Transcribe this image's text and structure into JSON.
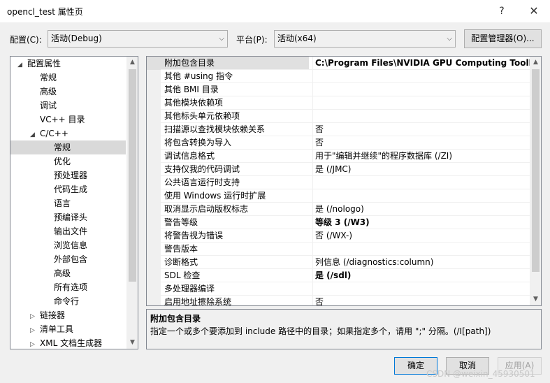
{
  "window": {
    "title": "opencl_test 属性页",
    "help_glyph": "?",
    "close_glyph": "✕"
  },
  "config": {
    "label": "配置(C):",
    "value": "活动(Debug)"
  },
  "platform": {
    "label": "平台(P):",
    "value": "活动(x64)"
  },
  "config_manager_label": "配置管理器(O)...",
  "tree": {
    "items": [
      {
        "label": "配置属性",
        "expander": "◢",
        "level": 0,
        "selected": false
      },
      {
        "label": "常规",
        "expander": "",
        "level": 1,
        "selected": false
      },
      {
        "label": "高级",
        "expander": "",
        "level": 1,
        "selected": false
      },
      {
        "label": "调试",
        "expander": "",
        "level": 1,
        "selected": false
      },
      {
        "label": "VC++ 目录",
        "expander": "",
        "level": 1,
        "selected": false
      },
      {
        "label": "C/C++",
        "expander": "◢",
        "level": 1,
        "selected": false
      },
      {
        "label": "常规",
        "expander": "",
        "level": 2,
        "selected": true
      },
      {
        "label": "优化",
        "expander": "",
        "level": 2,
        "selected": false
      },
      {
        "label": "预处理器",
        "expander": "",
        "level": 2,
        "selected": false
      },
      {
        "label": "代码生成",
        "expander": "",
        "level": 2,
        "selected": false
      },
      {
        "label": "语言",
        "expander": "",
        "level": 2,
        "selected": false
      },
      {
        "label": "预编译头",
        "expander": "",
        "level": 2,
        "selected": false
      },
      {
        "label": "输出文件",
        "expander": "",
        "level": 2,
        "selected": false
      },
      {
        "label": "浏览信息",
        "expander": "",
        "level": 2,
        "selected": false
      },
      {
        "label": "外部包含",
        "expander": "",
        "level": 2,
        "selected": false
      },
      {
        "label": "高级",
        "expander": "",
        "level": 2,
        "selected": false
      },
      {
        "label": "所有选项",
        "expander": "",
        "level": 2,
        "selected": false
      },
      {
        "label": "命令行",
        "expander": "",
        "level": 2,
        "selected": false
      },
      {
        "label": "链接器",
        "expander": "▷",
        "level": 1,
        "selected": false
      },
      {
        "label": "清单工具",
        "expander": "▷",
        "level": 1,
        "selected": false
      },
      {
        "label": "XML 文档生成器",
        "expander": "▷",
        "level": 1,
        "selected": false
      }
    ]
  },
  "properties": [
    {
      "name": "附加包含目录",
      "value": "C:\\Program Files\\NVIDIA GPU Computing Toolkit\\",
      "bold": true,
      "selected": true
    },
    {
      "name": "其他 #using 指令",
      "value": "",
      "bold": false,
      "selected": false
    },
    {
      "name": "其他 BMI 目录",
      "value": "",
      "bold": false,
      "selected": false
    },
    {
      "name": "其他模块依赖项",
      "value": "",
      "bold": false,
      "selected": false
    },
    {
      "name": "其他标头单元依赖项",
      "value": "",
      "bold": false,
      "selected": false
    },
    {
      "name": "扫描源以查找模块依赖关系",
      "value": "否",
      "bold": false,
      "selected": false
    },
    {
      "name": "将包含转换为导入",
      "value": "否",
      "bold": false,
      "selected": false
    },
    {
      "name": "调试信息格式",
      "value": "用于\"编辑并继续\"的程序数据库 (/ZI)",
      "bold": false,
      "selected": false
    },
    {
      "name": "支持仅我的代码调试",
      "value": "是 (/JMC)",
      "bold": false,
      "selected": false
    },
    {
      "name": "公共语言运行时支持",
      "value": "",
      "bold": false,
      "selected": false
    },
    {
      "name": "使用 Windows 运行时扩展",
      "value": "",
      "bold": false,
      "selected": false
    },
    {
      "name": "取消显示启动版权标志",
      "value": "是 (/nologo)",
      "bold": false,
      "selected": false
    },
    {
      "name": "警告等级",
      "value": "等级 3 (/W3)",
      "bold": true,
      "selected": false
    },
    {
      "name": "将警告视为错误",
      "value": "否 (/WX-)",
      "bold": false,
      "selected": false
    },
    {
      "name": "警告版本",
      "value": "",
      "bold": false,
      "selected": false
    },
    {
      "name": "诊断格式",
      "value": "列信息 (/diagnostics:column)",
      "bold": false,
      "selected": false
    },
    {
      "name": "SDL 检查",
      "value": "是 (/sdl)",
      "bold": true,
      "selected": false
    },
    {
      "name": "多处理器编译",
      "value": "",
      "bold": false,
      "selected": false
    },
    {
      "name": "启用地址擦除系统",
      "value": "否",
      "bold": false,
      "selected": false
    }
  ],
  "description": {
    "title": "附加包含目录",
    "text": "指定一个或多个要添加到 include 路径中的目录；如果指定多个，请用 \";\" 分隔。(/I[path])"
  },
  "buttons": {
    "ok": "确定",
    "cancel": "取消",
    "apply": "应用(A)"
  },
  "scroll_glyphs": {
    "up": "▲",
    "down": "▼",
    "dropdown": "⌵"
  },
  "watermark": "CSDN @weixin_45930501"
}
